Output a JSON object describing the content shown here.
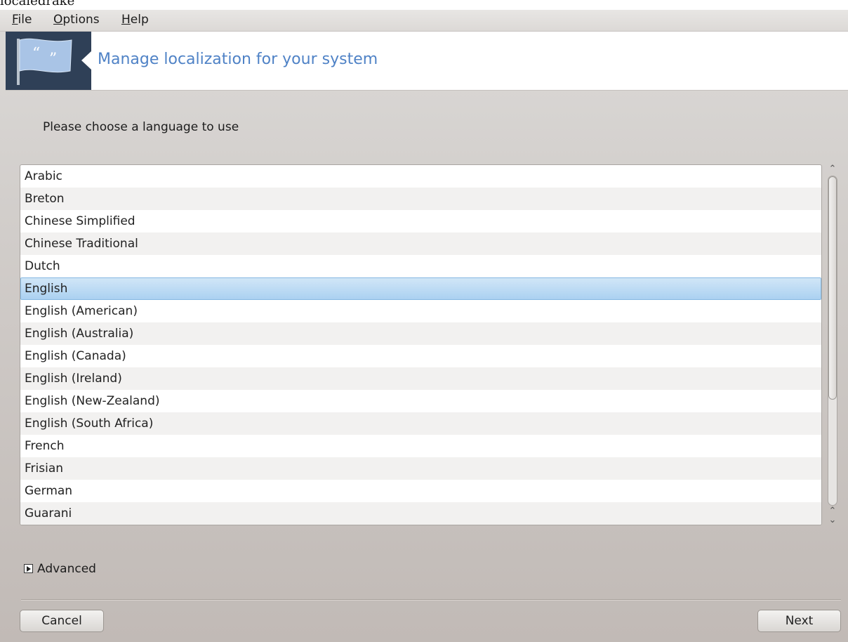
{
  "window": {
    "title": "localedrake"
  },
  "menu": [
    {
      "mnemonic": "F",
      "rest": "ile"
    },
    {
      "mnemonic": "O",
      "rest": "ptions"
    },
    {
      "mnemonic": "H",
      "rest": "elp"
    }
  ],
  "banner": {
    "title": "Manage localization for your system",
    "icon": "flag-quotes-icon"
  },
  "prompt": "Please choose a language to use",
  "languages": [
    "Arabic",
    "Breton",
    "Chinese Simplified",
    "Chinese Traditional",
    "Dutch",
    "English",
    "English (American)",
    "English (Australia)",
    "English (Canada)",
    "English (Ireland)",
    "English (New-Zealand)",
    "English (South Africa)",
    "French",
    "Frisian",
    "German",
    "Guarani"
  ],
  "selected_language": "English",
  "advanced": {
    "label": "Advanced",
    "expanded": false
  },
  "buttons": {
    "cancel": "Cancel",
    "next": "Next"
  },
  "colors": {
    "banner_title": "#4f82c6",
    "logo_background": "#2f4057",
    "selection": "#abd1f1"
  }
}
